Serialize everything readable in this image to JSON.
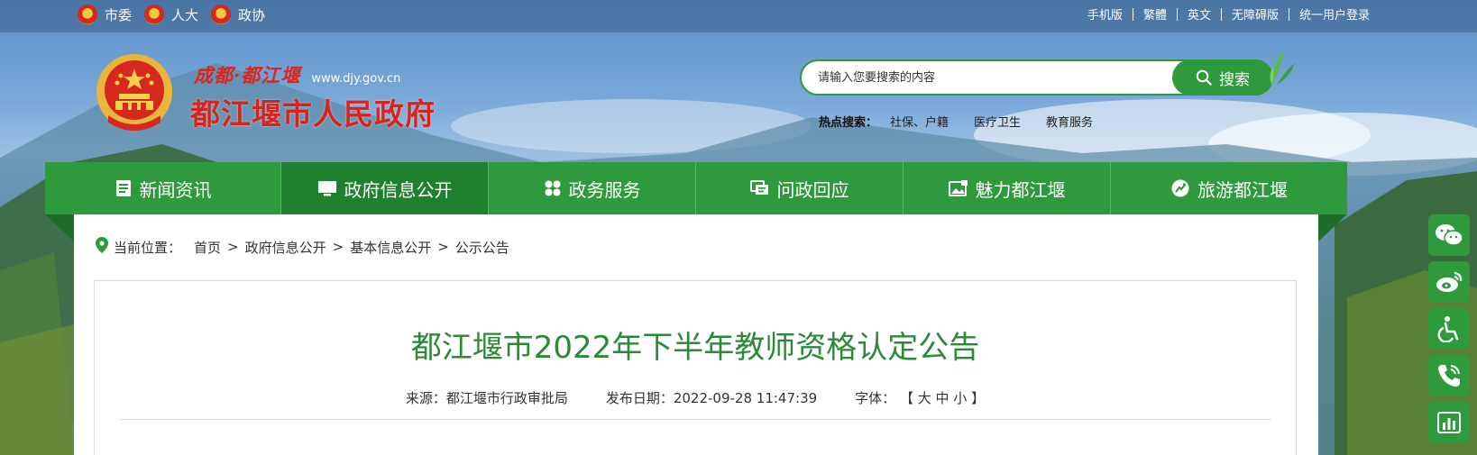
{
  "topbar": {
    "left": [
      {
        "label": "市委",
        "icon": "party-emblem-icon"
      },
      {
        "label": "人大",
        "icon": "national-emblem-icon"
      },
      {
        "label": "政协",
        "icon": "cppcc-emblem-icon"
      }
    ],
    "right": [
      "手机版",
      "繁體",
      "英文",
      "无障碍版",
      "统一用户登录"
    ]
  },
  "header": {
    "site_sub": "成都·都江堰",
    "site_url": "www.djy.gov.cn",
    "site_title": "都江堰市人民政府"
  },
  "search": {
    "placeholder": "请输入您要搜索的内容",
    "button_label": "搜索",
    "hot_label": "热点搜索：",
    "hot_items": [
      "社保、户籍",
      "医疗卫生",
      "教育服务"
    ]
  },
  "nav": {
    "items": [
      {
        "label": "新闻资讯",
        "icon": "news-icon"
      },
      {
        "label": "政府信息公开",
        "icon": "monitor-icon",
        "active": true
      },
      {
        "label": "政务服务",
        "icon": "grid-icon"
      },
      {
        "label": "问政回应",
        "icon": "chat-icon"
      },
      {
        "label": "魅力都江堰",
        "icon": "photo-icon"
      },
      {
        "label": "旅游都江堰",
        "icon": "travel-icon"
      }
    ]
  },
  "breadcrumb": {
    "label": "当前位置：",
    "items": [
      "首页",
      "政府信息公开",
      "基本信息公开",
      "公示公告"
    ]
  },
  "article": {
    "title": "都江堰市2022年下半年教师资格认定公告",
    "source": "来源：都江堰市行政审批局",
    "date": "发布日期：2022-09-28 11:47:39",
    "font_label": "字体：",
    "font_open": "【",
    "font_large": "大",
    "font_medium": "中",
    "font_small": "小",
    "font_close": "】"
  },
  "floatbar": [
    "wechat-icon",
    "weibo-icon",
    "accessibility-icon",
    "phone-icon",
    "chart-icon"
  ],
  "colors": {
    "primary_green": "#2f9a3d",
    "active_green": "#1f8030",
    "title_red": "#d8251c",
    "title_green": "#2b8a38"
  }
}
